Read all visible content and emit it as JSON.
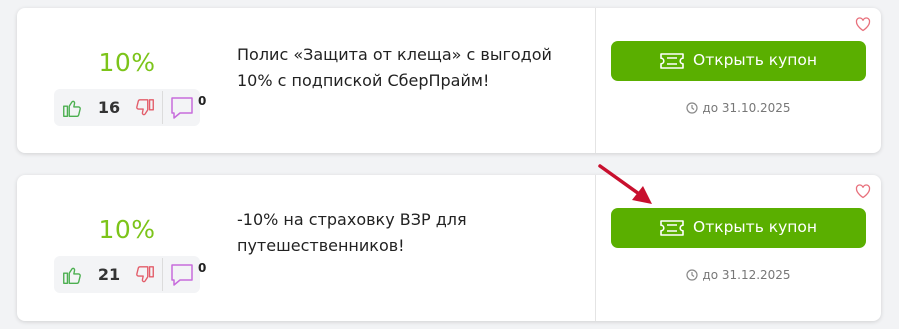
{
  "coupons": [
    {
      "discount": "10%",
      "votes": "16",
      "comments": "0",
      "description": "Полис «Защита от клеща» с выгодой 10% с подпиской СберПрайм!",
      "button_label": "Открыть купон",
      "expiry": "до 31.10.2025"
    },
    {
      "discount": "10%",
      "votes": "21",
      "comments": "0",
      "description": "-10% на страховку ВЗР для путешественников!",
      "button_label": "Открыть купон",
      "expiry": "до 31.12.2025"
    }
  ],
  "colors": {
    "discount": "#7cc41a",
    "button": "#5aaf00",
    "like": "#4caf50",
    "dislike": "#e35d6a",
    "comment": "#c76cdc",
    "heart": "#e8707c",
    "arrow": "#c8102e"
  },
  "icons": [
    "thumbs-up-icon",
    "thumbs-down-icon",
    "comment-icon",
    "ticket-icon",
    "clock-icon",
    "heart-icon",
    "arrow-icon"
  ]
}
